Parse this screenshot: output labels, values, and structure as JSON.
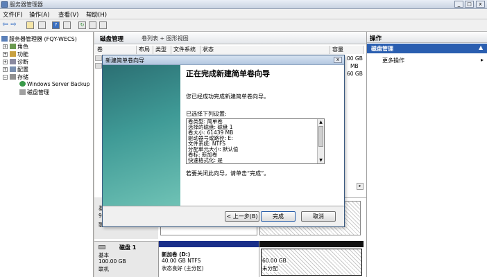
{
  "window": {
    "title": "服务器管理器",
    "min": "_",
    "max": "□",
    "close": "x"
  },
  "menu": [
    "文件(F)",
    "操作(A)",
    "查看(V)",
    "帮助(H)"
  ],
  "tree": {
    "root": "服务器管理器 (FQY-WECS)",
    "items": [
      "角色",
      "功能",
      "诊断",
      "配置",
      "存储"
    ],
    "storage_children": [
      "Windows Server Backup",
      "磁盘管理"
    ]
  },
  "center": {
    "header_title": "磁盘管理",
    "header_view": "卷列表 + 图形视图",
    "columns": [
      "卷",
      "布局",
      "类型",
      "文件系统",
      "状态",
      "容量"
    ],
    "capacity_fragments": [
      "00 GB",
      "MB",
      "60 GB"
    ],
    "disk": {
      "name": "磁盘 1",
      "type": "基本",
      "size": "100.00 GB",
      "status": "联机",
      "vol_name": "新加卷 (D:)",
      "vol_size": "40.00 GB NTFS",
      "vol_status": "状态良好 (主分区)",
      "unalloc_size": "60.00 GB",
      "unalloc_status": "未分配"
    },
    "disk0_fragments": [
      "基",
      "9",
      "联"
    ]
  },
  "actions": {
    "title": "操作",
    "section": "磁盘管理",
    "more": "更多操作"
  },
  "dialog": {
    "title": "新建简单卷向导",
    "heading": "正在完成新建简单卷向导",
    "intro": "您已经成功完成新建简单卷向导。",
    "selected_label": "已选择下列设置:",
    "settings": [
      "卷类型: 简单卷",
      "选择的磁盘: 磁盘 1",
      "卷大小: 61439 MB",
      "驱动器号或路径: E:",
      "文件系统: NTFS",
      "分配单元大小: 默认值",
      "卷标: 新加卷",
      "快速格式化: 是"
    ],
    "close_hint": "若要关闭此向导，请单击“完成”。",
    "back": "< 上一步(B)",
    "finish": "完成",
    "cancel": "取消",
    "close": "x"
  }
}
